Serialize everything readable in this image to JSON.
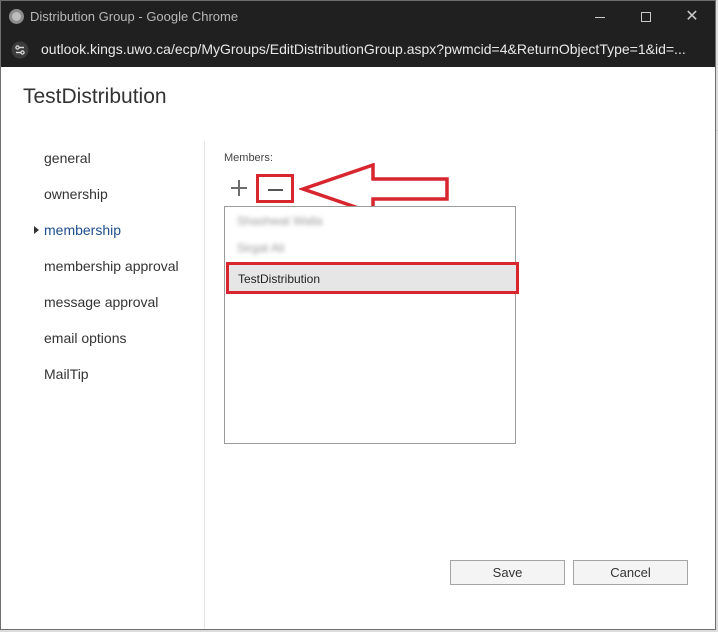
{
  "window": {
    "title": "Distribution Group - Google Chrome",
    "url": "outlook.kings.uwo.ca/ecp/MyGroups/EditDistributionGroup.aspx?pwmcid=4&ReturnObjectType=1&id=..."
  },
  "page": {
    "title": "TestDistribution"
  },
  "nav": {
    "items": [
      {
        "label": "general"
      },
      {
        "label": "ownership"
      },
      {
        "label": "membership"
      },
      {
        "label": "membership approval"
      },
      {
        "label": "message approval"
      },
      {
        "label": "email options"
      },
      {
        "label": "MailTip"
      }
    ],
    "active_index": 2
  },
  "members": {
    "label": "Members:",
    "list": [
      {
        "name": "Shashwat Walla"
      },
      {
        "name": "Sirgat Ali"
      },
      {
        "name": "TestDistribution"
      }
    ],
    "selected_index": 2
  },
  "buttons": {
    "save": "Save",
    "cancel": "Cancel"
  },
  "colors": {
    "accent_nav": "#1e4e8c",
    "annotation_red": "#d7262e"
  }
}
